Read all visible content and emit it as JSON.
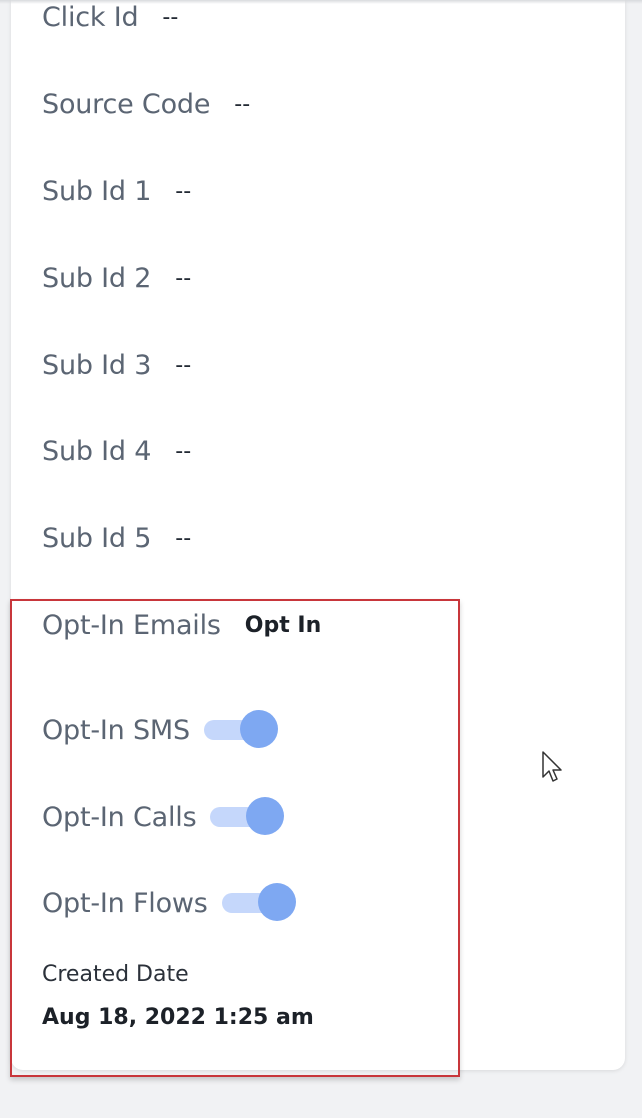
{
  "fields": [
    {
      "label": "Click Id",
      "value": "--"
    },
    {
      "label": "Source Code",
      "value": "--"
    },
    {
      "label": "Sub Id 1",
      "value": "--"
    },
    {
      "label": "Sub Id 2",
      "value": "--"
    },
    {
      "label": "Sub Id 3",
      "value": "--"
    },
    {
      "label": "Sub Id 4",
      "value": "--"
    },
    {
      "label": "Sub Id 5",
      "value": "--"
    }
  ],
  "opt_in": {
    "emails": {
      "label": "Opt-In Emails",
      "value": "Opt In"
    },
    "sms": {
      "label": "Opt-In SMS",
      "enabled": true
    },
    "calls": {
      "label": "Opt-In Calls",
      "enabled": true
    },
    "flows": {
      "label": "Opt-In Flows",
      "enabled": true
    }
  },
  "created": {
    "label": "Created Date",
    "value": "Aug 18, 2022 1:25 am"
  },
  "colors": {
    "toggle_track": "#c5d7fb",
    "toggle_knob": "#7ea8f2",
    "highlight_border": "#c8363b"
  }
}
